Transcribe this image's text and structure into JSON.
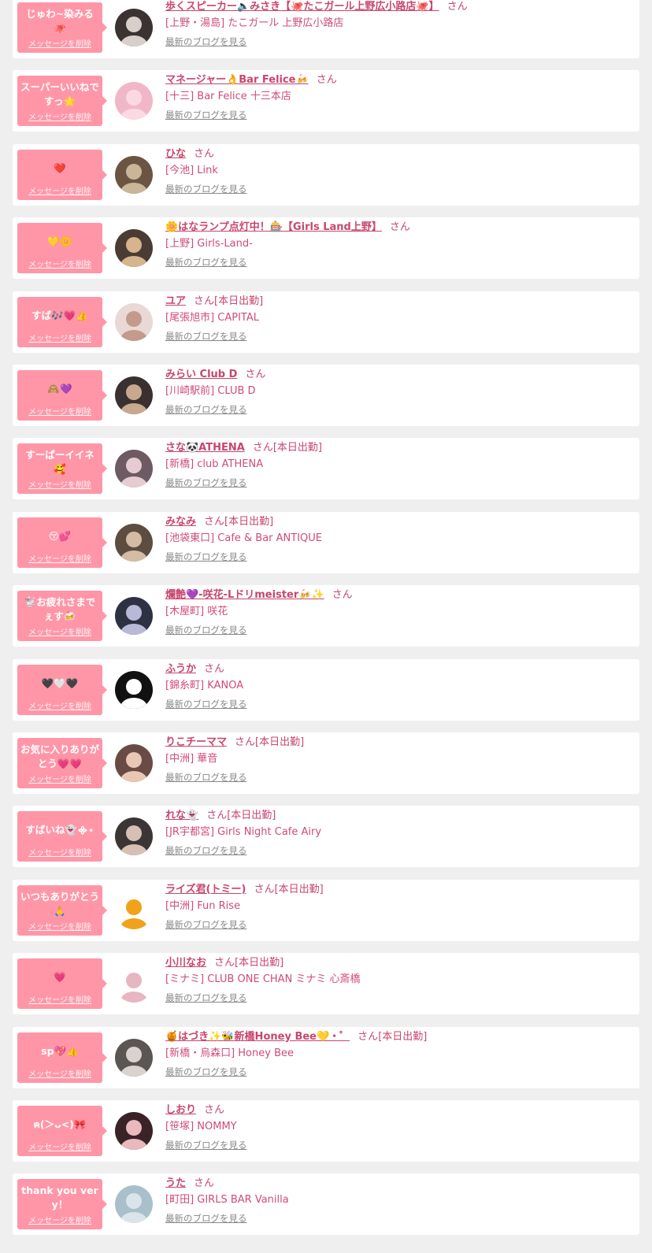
{
  "delete_label": "メッセージを削除",
  "blog_label": "最新のブログを見る",
  "san_label": "さん",
  "colors": {
    "page_bg": "#efefef",
    "bubble": "#ff96a8",
    "name": "#c8466d"
  },
  "items": [
    {
      "message": "じゅわ~染みる🐙",
      "name": "歩くスピーカー🔈みさき【🐙たこガール上野広小路店🐙】",
      "status": "",
      "shop": "[上野・湯島] たこガール 上野広小路店",
      "avatar": {
        "bg": "#3b3232",
        "fg": "#d9cfca"
      }
    },
    {
      "message": "スーパーいいねですっ🌟",
      "name": "マネージャー👌Bar Felice🍻",
      "status": "",
      "shop": "[十三] Bar Felice 十三本店",
      "avatar": {
        "bg": "#f2b6c9",
        "fg": "#fbd9e3"
      }
    },
    {
      "message": "❤️",
      "name": "ひな",
      "status": "",
      "shop": "[今池] Link",
      "avatar": {
        "bg": "#6b5542",
        "fg": "#c9b597"
      }
    },
    {
      "message": "💛🌼",
      "name": "🌼はなランプ点灯中！🎰【Girls Land上野】",
      "status": "",
      "shop": "[上野] Girls-Land-",
      "avatar": {
        "bg": "#4a3c35",
        "fg": "#d6b48c"
      }
    },
    {
      "message": "すば🎶💗👍",
      "name": "ユア",
      "status": "[本日出勤]",
      "shop": "[尾張旭市] CAPITAL",
      "avatar": {
        "bg": "#e9d9d6",
        "fg": "#c49a8c"
      }
    },
    {
      "message": "🙈💜",
      "name": "みらい Club D",
      "status": "",
      "shop": "[川崎駅前] CLUB D",
      "avatar": {
        "bg": "#3a3030",
        "fg": "#c8a98f"
      }
    },
    {
      "message": "すーぱーイイネ🥰",
      "name": "さな🐼ATHENA",
      "status": "[本日出勤]",
      "shop": "[新橋] club ATHENA",
      "avatar": {
        "bg": "#6d5a63",
        "fg": "#e6ccd2"
      }
    },
    {
      "message": "😚💕",
      "name": "みなみ",
      "status": "[本日出勤]",
      "shop": "[池袋東口] Cafe & Bar ANTIQUE",
      "avatar": {
        "bg": "#5d4d40",
        "fg": "#d4bca4"
      }
    },
    {
      "message": "🐩お疲れさまでぇす🍻",
      "name": "爛艶💜-咲花-Lドリmeister🍻✨",
      "status": "",
      "shop": "[木屋町] 咲花",
      "avatar": {
        "bg": "#2d3142",
        "fg": "#b7b9d6"
      }
    },
    {
      "message": "🖤🤍🖤",
      "name": "ふうか",
      "status": "",
      "shop": "[錦糸町] KANOA",
      "avatar": {
        "bg": "#111111",
        "fg": "#ffffff"
      }
    },
    {
      "message": "お気に入りありがとう💗💗",
      "name": "りこチーママ",
      "status": "[本日出勤]",
      "shop": "[中洲] 華音",
      "avatar": {
        "bg": "#6a4a44",
        "fg": "#e8c7b4"
      }
    },
    {
      "message": "すばいね👻᯽⋆",
      "name": "れな👻",
      "status": "[本日出勤]",
      "shop": "[JR宇都宮] Girls Night Cafe Airy",
      "avatar": {
        "bg": "#3c3536",
        "fg": "#d8bfb4"
      }
    },
    {
      "message": "いつもありがとう🙏",
      "name": "ライズ君(トミー)",
      "status": "[本日出勤]",
      "shop": "[中洲] Fun Rise",
      "avatar": {
        "bg": "#ffffff",
        "fg": "#f0a21a"
      }
    },
    {
      "message": "💗",
      "name": "小川なお",
      "status": "[本日出勤]",
      "shop": "[ミナミ] CLUB ONE CHAN ミナミ 心斎橋",
      "avatar": {
        "bg": "#ffffff",
        "fg": "#e6b6c1"
      }
    },
    {
      "message": "sp💖👍",
      "name": "🍯はづき✨🐝新橋Honey Bee💛・゜",
      "status": "[本日出勤]",
      "shop": "[新橋・烏森口] Honey Bee",
      "avatar": {
        "bg": "#5b5553",
        "fg": "#d9d2ce"
      }
    },
    {
      "message": "ฅ(＞ᴗ<)🎀",
      "name": "しおり",
      "status": "",
      "shop": "[笹塚] NOMMY",
      "avatar": {
        "bg": "#3a2326",
        "fg": "#e8b9bd"
      }
    },
    {
      "message": "thank you very！",
      "name": "うた",
      "status": "",
      "shop": "[町田] GIRLS BAR Vanilla",
      "avatar": {
        "bg": "#a9bfc9",
        "fg": "#d9e5ea"
      }
    }
  ]
}
